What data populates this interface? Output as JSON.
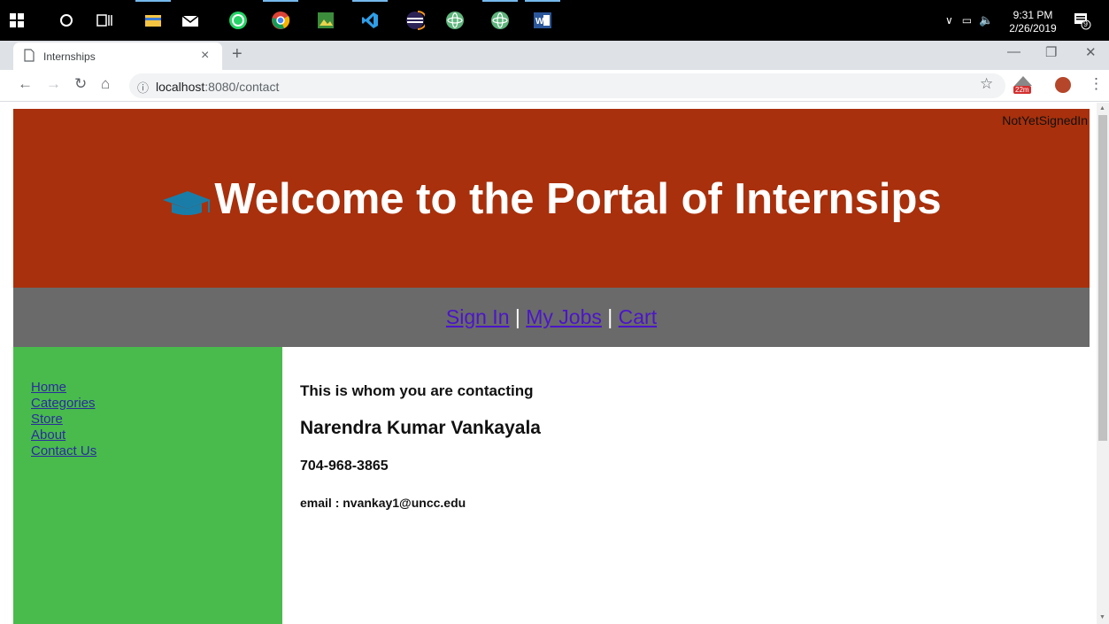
{
  "taskbar": {
    "clock_time": "9:31 PM",
    "clock_date": "2/26/2019",
    "notification_count": "9"
  },
  "browser": {
    "tab_title": "Internships",
    "url_host": "localhost",
    "url_path": ":8080/contact",
    "extension_badge": "22m"
  },
  "page": {
    "signed_status": "NotYetSignedIn",
    "welcome_title": "Welcome to the Portal of Internsips",
    "nav": {
      "sign_in": "Sign In",
      "my_jobs": "My Jobs",
      "cart": "Cart",
      "separator": "|"
    },
    "sidebar": {
      "items": [
        "Home",
        "Categories",
        "Store",
        "About",
        "Contact Us"
      ]
    },
    "contact": {
      "intro": "This is whom you are contacting",
      "name": "Narendra Kumar Vankayala",
      "phone": "704-968-3865",
      "email": "email : nvankay1@uncc.edu"
    }
  },
  "colors": {
    "header_bg": "#a8300c",
    "nav_bg": "#6a6a6a",
    "sidebar_bg": "#48bb4c",
    "link": "#4b16c8",
    "cap_icon": "#1a7da8"
  }
}
